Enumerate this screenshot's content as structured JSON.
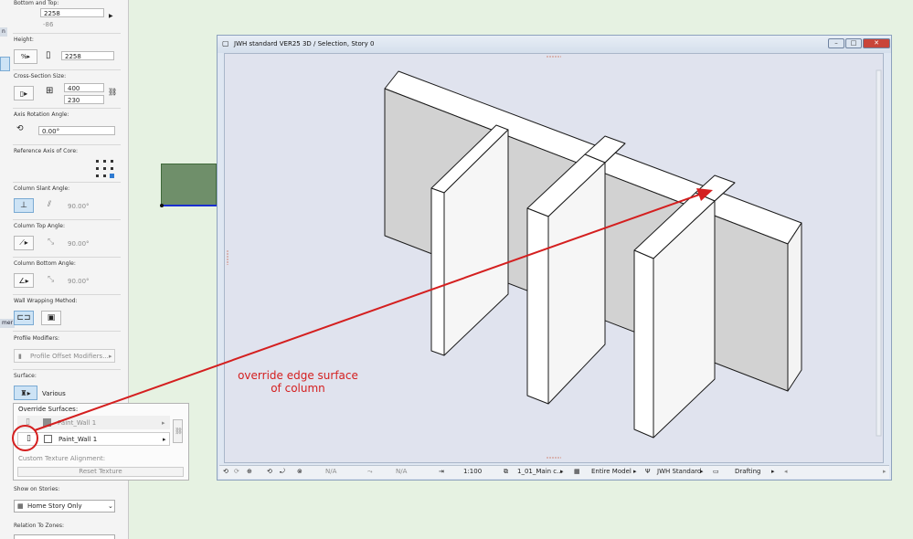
{
  "panel": {
    "tab_n": "n",
    "tab_mer": "mer",
    "bottom_top_label": "Bottom and Top:",
    "bottom_top_value": "2258",
    "bottom_top_sub": "-86",
    "height_label": "Height:",
    "height_value": "2258",
    "cross_section_label": "Cross-Section Size:",
    "cross_w": "400",
    "cross_h": "230",
    "axis_rotation_label": "Axis Rotation Angle:",
    "axis_rotation_value": "0.00°",
    "reference_axis_label": "Reference Axis of Core:",
    "slant_label": "Column Slant Angle:",
    "slant_value": "90.00°",
    "top_angle_label": "Column Top Angle:",
    "top_angle_value": "90.00°",
    "bottom_angle_label": "Column Bottom Angle:",
    "bottom_angle_value": "90.00°",
    "wrapping_label": "Wall Wrapping Method:",
    "profile_label": "Profile Modifiers:",
    "profile_button": "Profile Offset Modifiers...",
    "surface_label": "Surface:",
    "surface_value": "Various",
    "override_title": "Override Surfaces:",
    "override_row1": "Paint_Wall 1",
    "override_row2": "Paint_Wall 1",
    "custom_texture_label": "Custom Texture Alignment:",
    "reset_texture": "Reset Texture",
    "show_on_stories_label": "Show on Stories:",
    "show_on_stories_value": "Home Story Only",
    "relation_label": "Relation To Zones:"
  },
  "window": {
    "title": "JWH standard VER25 3D / Selection, Story 0",
    "min": "–",
    "max": "□",
    "close": "✕"
  },
  "status": {
    "na1": "N/A",
    "na2": "N/A",
    "scale": "1:100",
    "layer": "1_01_Main c...",
    "model": "Entire Model",
    "pen": "JWH Standard",
    "mode": "Drafting"
  },
  "annotation": {
    "line1": "override edge surface",
    "line2": "of column"
  },
  "colors": {
    "annotation": "#d41f1f",
    "green_rect": "#6f8f6a",
    "selected_button": "#cde3f5",
    "viewport_bg": "#e0e3ee"
  }
}
